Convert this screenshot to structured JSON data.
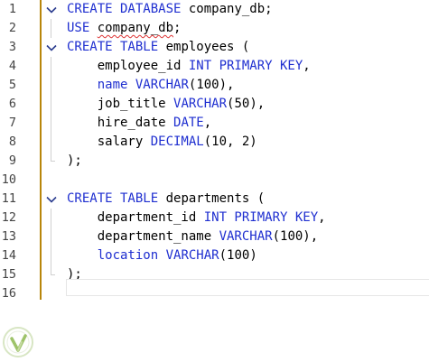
{
  "editor": {
    "colors": {
      "keyword": "#1f2fd0",
      "identifier": "#000000",
      "line_number": "#444444",
      "change_bar": "#b8860b",
      "spell_squiggle": "#dd3333"
    },
    "lines": [
      {
        "number": "1",
        "fold": "open",
        "tokens": [
          {
            "t": "kw",
            "v": "CREATE DATABASE"
          },
          {
            "t": "id",
            "v": " company_db;"
          }
        ]
      },
      {
        "number": "2",
        "fold": "guide",
        "tokens": [
          {
            "t": "kw",
            "v": "USE"
          },
          {
            "t": "id",
            "v": " "
          },
          {
            "t": "sq",
            "v": "company_db"
          },
          {
            "t": "p",
            "v": ";"
          }
        ]
      },
      {
        "number": "3",
        "fold": "open",
        "tokens": [
          {
            "t": "kw",
            "v": "CREATE TABLE"
          },
          {
            "t": "id",
            "v": " employees ("
          }
        ]
      },
      {
        "number": "4",
        "fold": "guide",
        "tokens": [
          {
            "t": "id",
            "v": "    employee_id "
          },
          {
            "t": "kw",
            "v": "INT PRIMARY KEY"
          },
          {
            "t": "p",
            "v": ","
          }
        ]
      },
      {
        "number": "5",
        "fold": "guide",
        "tokens": [
          {
            "t": "kw",
            "v": "    name"
          },
          {
            "t": "id",
            "v": " "
          },
          {
            "t": "kw",
            "v": "VARCHAR"
          },
          {
            "t": "p",
            "v": "(100),"
          }
        ]
      },
      {
        "number": "6",
        "fold": "guide",
        "tokens": [
          {
            "t": "id",
            "v": "    job_title "
          },
          {
            "t": "kw",
            "v": "VARCHAR"
          },
          {
            "t": "p",
            "v": "(50),"
          }
        ]
      },
      {
        "number": "7",
        "fold": "guide",
        "tokens": [
          {
            "t": "id",
            "v": "    hire_date "
          },
          {
            "t": "kw",
            "v": "DATE"
          },
          {
            "t": "p",
            "v": ","
          }
        ]
      },
      {
        "number": "8",
        "fold": "guide",
        "tokens": [
          {
            "t": "id",
            "v": "    salary "
          },
          {
            "t": "kw",
            "v": "DECIMAL"
          },
          {
            "t": "p",
            "v": "(10, 2)"
          }
        ]
      },
      {
        "number": "9",
        "fold": "end",
        "tokens": [
          {
            "t": "p",
            "v": ");"
          }
        ]
      },
      {
        "number": "10",
        "fold": "none",
        "tokens": []
      },
      {
        "number": "11",
        "fold": "open",
        "tokens": [
          {
            "t": "kw",
            "v": "CREATE TABLE"
          },
          {
            "t": "id",
            "v": " departments ("
          }
        ]
      },
      {
        "number": "12",
        "fold": "guide",
        "tokens": [
          {
            "t": "id",
            "v": "    department_id "
          },
          {
            "t": "kw",
            "v": "INT PRIMARY KEY"
          },
          {
            "t": "p",
            "v": ","
          }
        ]
      },
      {
        "number": "13",
        "fold": "guide",
        "tokens": [
          {
            "t": "id",
            "v": "    department_name "
          },
          {
            "t": "kw",
            "v": "VARCHAR"
          },
          {
            "t": "p",
            "v": "(100),"
          }
        ]
      },
      {
        "number": "14",
        "fold": "guide",
        "tokens": [
          {
            "t": "kw",
            "v": "    location"
          },
          {
            "t": "id",
            "v": " "
          },
          {
            "t": "kw",
            "v": "VARCHAR"
          },
          {
            "t": "p",
            "v": "(100)"
          }
        ]
      },
      {
        "number": "15",
        "fold": "end",
        "tokens": [
          {
            "t": "p",
            "v": ");"
          }
        ]
      },
      {
        "number": "16",
        "fold": "none",
        "tokens": []
      }
    ],
    "current_line": "16"
  },
  "watermark": {
    "icon": "leaf-logo-icon"
  }
}
